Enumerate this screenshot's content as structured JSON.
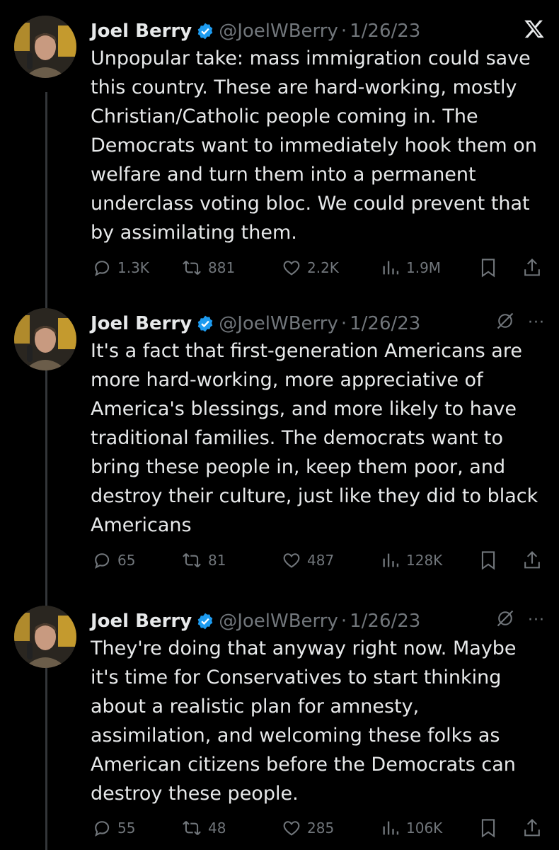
{
  "tweets": [
    {
      "name": "Joel Berry",
      "handle": "@JoelWBerry",
      "dot": "·",
      "date": "1/26/23",
      "corner_icon": "x-logo-icon",
      "text": "Unpopular take: mass immigration could save this country. These are hard-working, mostly Christian/Catholic people coming in. The Democrats want to immediately hook them on welfare and turn them into a permanent underclass voting bloc. We could prevent that by assimilating them.",
      "replies": "1.3K",
      "reposts": "881",
      "likes": "2.2K",
      "views": "1.9M"
    },
    {
      "name": "Joel Berry",
      "handle": "@JoelWBerry",
      "dot": "·",
      "date": "1/26/23",
      "corner_icon": "grok-icon",
      "more": "···",
      "text": "It's a fact that first-generation Americans are more hard-working, more appreciative of America's blessings, and more likely to have traditional families. The democrats want to bring these people in, keep them poor, and destroy their culture, just like they did to black Americans",
      "replies": "65",
      "reposts": "81",
      "likes": "487",
      "views": "128K"
    },
    {
      "name": "Joel Berry",
      "handle": "@JoelWBerry",
      "dot": "·",
      "date": "1/26/23",
      "corner_icon": "grok-icon",
      "more": "···",
      "text": "They're doing that anyway right now. Maybe it's time for Conservatives to start thinking about a realistic plan for amnesty, assimilation, and welcoming these folks as American citizens before the Democrats can destroy these people.",
      "replies": "55",
      "reposts": "48",
      "likes": "285",
      "views": "106K"
    }
  ],
  "colors": {
    "background": "#000000",
    "text": "#e7e9ea",
    "muted": "#71767b",
    "verified": "#1d9bf0",
    "thread_line": "#333639"
  }
}
